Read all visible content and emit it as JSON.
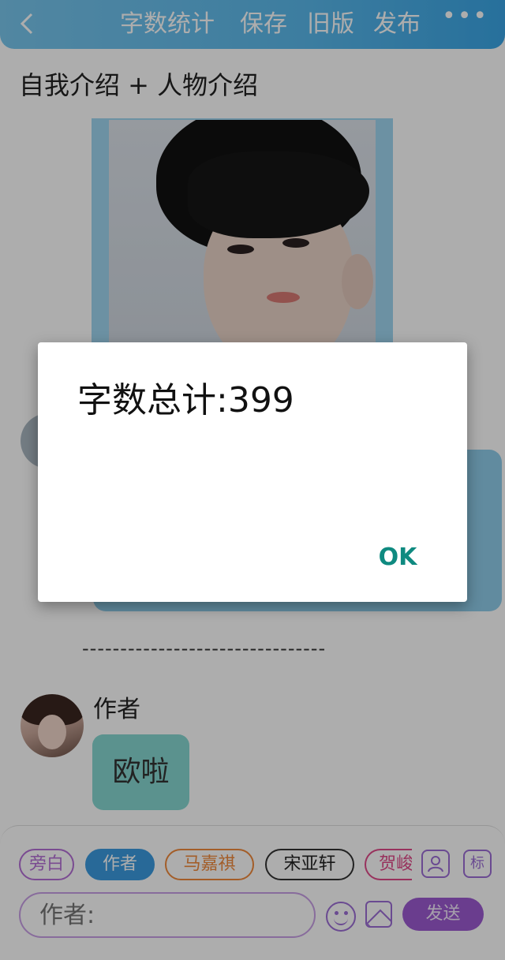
{
  "topbar": {
    "back_icon": "chevron-left",
    "menu": [
      "字数统计",
      "保存",
      "旧版",
      "发布"
    ],
    "more_icon": "more-horizontal"
  },
  "document": {
    "title": "自我介绍 + 人物介绍",
    "divider": "--------------------------------",
    "author_name": "作者",
    "author_message": "欧啦"
  },
  "chips": [
    "旁白",
    "作者",
    "马嘉祺",
    "宋亚轩",
    "贺峻"
  ],
  "chip_colors": {
    "旁白": "#b46fd6",
    "作者": "#3b9be0",
    "马嘉祺": "#f08a3c",
    "宋亚轩": "#333333",
    "贺峻": "#e04a8a"
  },
  "composer": {
    "input_placeholder": "作者:",
    "send_label": "发送",
    "tag_label": "标"
  },
  "dialog": {
    "message": "字数总计:399",
    "ok_label": "OK"
  }
}
